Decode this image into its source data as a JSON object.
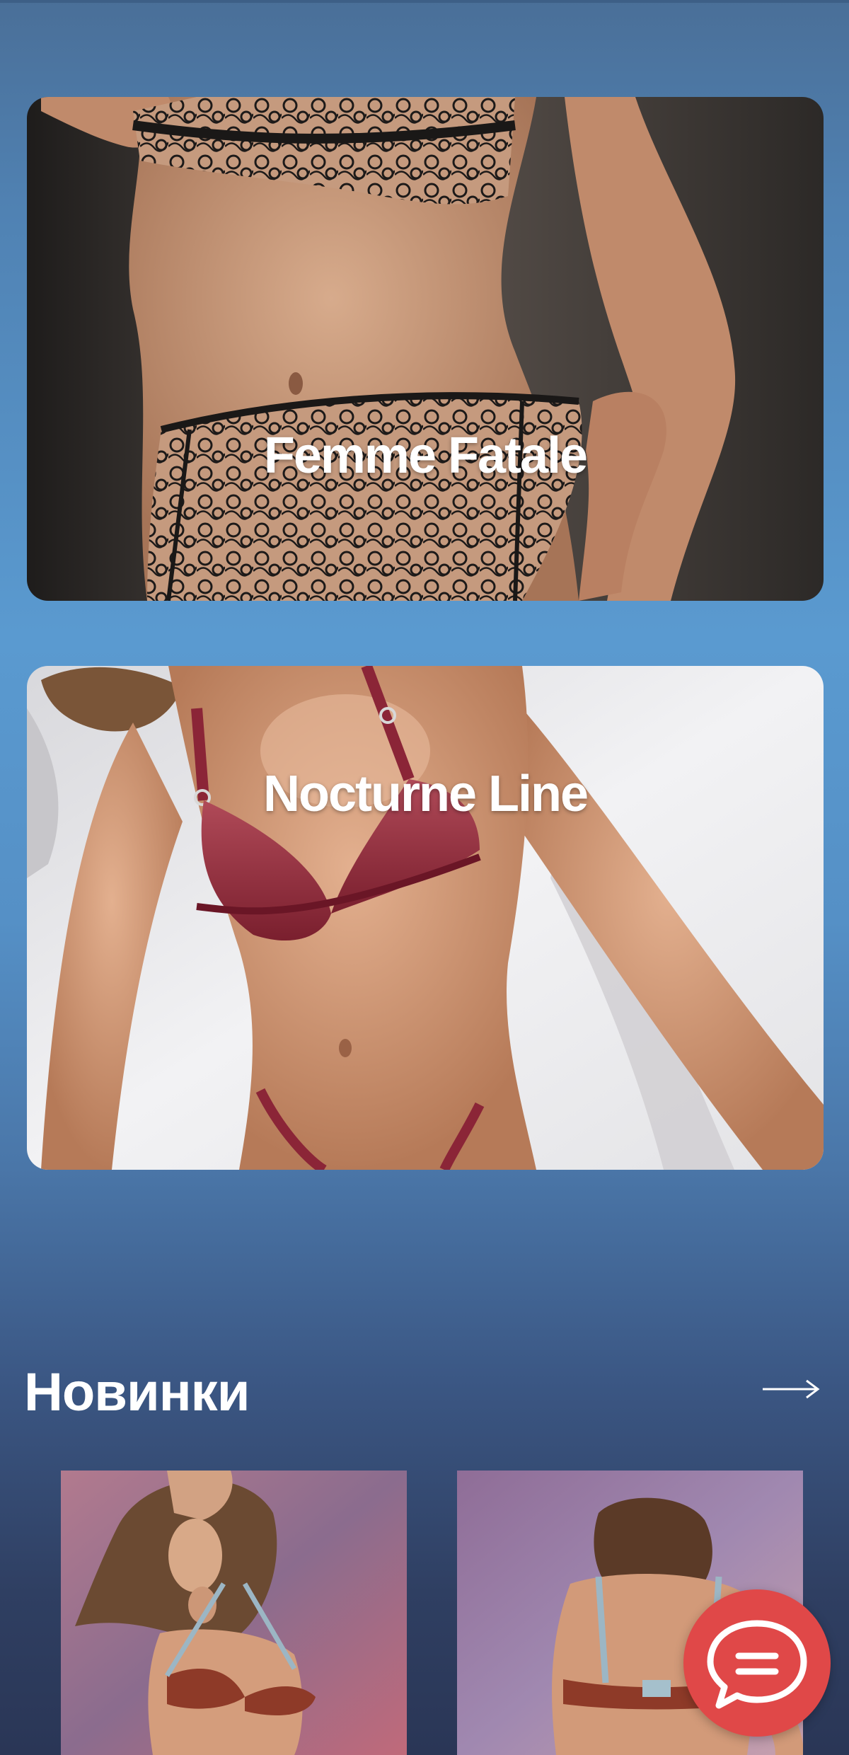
{
  "collections": [
    {
      "title": "Femme Fatale",
      "image": "lingerie-photo-black-lace"
    },
    {
      "title": "Nocturne Line",
      "image": "lingerie-photo-burgundy-mesh"
    }
  ],
  "new_arrivals": {
    "title": "Новинки",
    "arrow_icon": "arrow-right-icon",
    "products": [
      {
        "image": "product-photo-rust-bra-front"
      },
      {
        "image": "product-photo-rust-bra-back"
      }
    ]
  },
  "chat": {
    "icon": "chat-bubble-icon",
    "color": "#e04848"
  },
  "colors": {
    "background_top": "#4a6f98",
    "background_mid": "#5a9ad0",
    "background_bottom": "#2a3656",
    "title_text": "#ffffff"
  }
}
